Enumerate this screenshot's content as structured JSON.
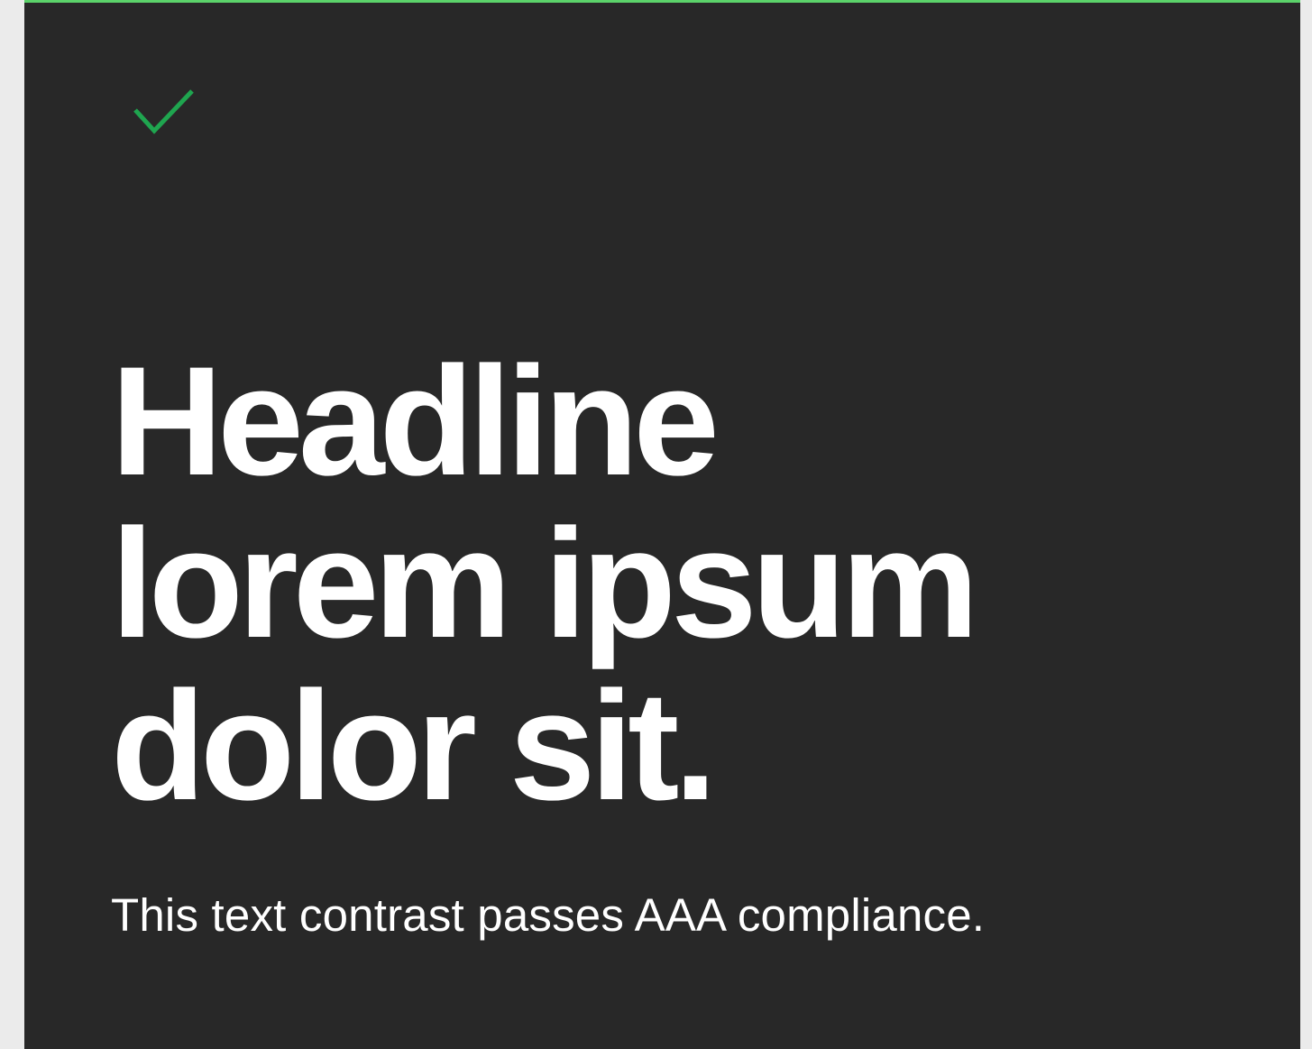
{
  "card": {
    "icon": "check-icon",
    "icon_color": "#1fa54f",
    "accent_color": "#5bd26a",
    "background_color": "#282828",
    "headline_lines": [
      "Headline",
      "lorem ipsum",
      "dolor sit."
    ],
    "subtext": "This text contrast passes AAA compliance."
  }
}
